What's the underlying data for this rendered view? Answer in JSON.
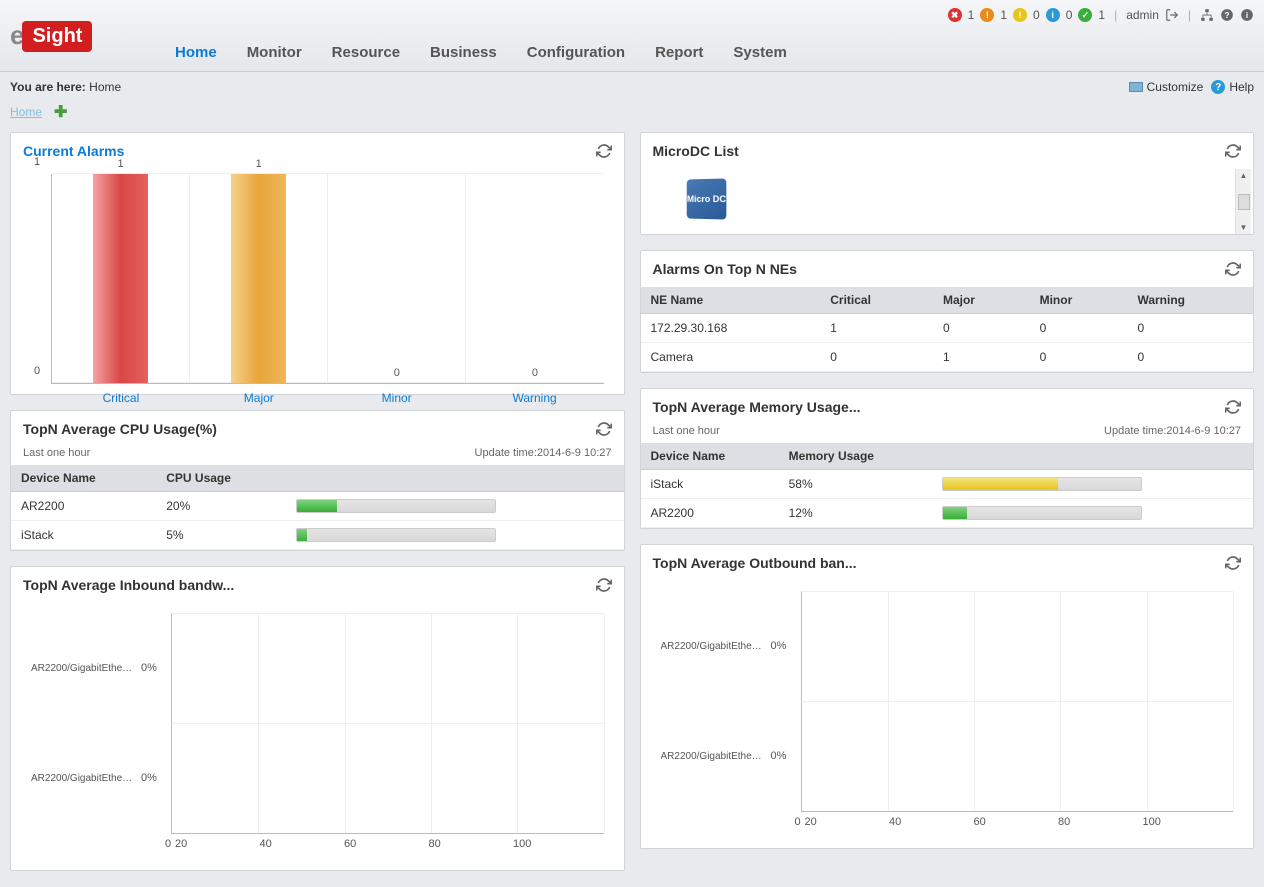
{
  "brand": {
    "prefix": "e",
    "name": "Sight"
  },
  "nav": {
    "items": [
      "Home",
      "Monitor",
      "Resource",
      "Business",
      "Configuration",
      "Report",
      "System"
    ],
    "active": 0
  },
  "status_counts": {
    "critical": "1",
    "major": "1",
    "warning": "0",
    "info": "0",
    "ok": "1"
  },
  "user": "admin",
  "breadcrumb": {
    "prefix": "You are here:",
    "location": "Home"
  },
  "actions": {
    "customize": "Customize",
    "help": "Help"
  },
  "tabs": {
    "home": "Home"
  },
  "panels": {
    "current_alarms": {
      "title": "Current Alarms"
    },
    "microdc": {
      "title": "MicroDC List",
      "cube": "Micro DC"
    },
    "alarms_top": {
      "title": "Alarms On Top N NEs",
      "headers": [
        "NE Name",
        "Critical",
        "Major",
        "Minor",
        "Warning"
      ],
      "rows": [
        [
          "172.29.30.168",
          "1",
          "0",
          "0",
          "0"
        ],
        [
          "Camera",
          "0",
          "1",
          "0",
          "0"
        ]
      ]
    },
    "cpu": {
      "title": "TopN Average CPU Usage(%)",
      "sub_left": "Last one hour",
      "sub_right": "Update time:2014-6-9 10:27",
      "headers": [
        "Device Name",
        "CPU Usage"
      ],
      "rows": [
        {
          "name": "AR2200",
          "pct": "20%",
          "val": 20
        },
        {
          "name": "iStack",
          "pct": "5%",
          "val": 5
        }
      ]
    },
    "mem": {
      "title": "TopN Average Memory Usage...",
      "sub_left": "Last one hour",
      "sub_right": "Update time:2014-6-9 10:27",
      "headers": [
        "Device Name",
        "Memory Usage"
      ],
      "rows": [
        {
          "name": "iStack",
          "pct": "58%",
          "val": 58,
          "color": "y"
        },
        {
          "name": "AR2200",
          "pct": "12%",
          "val": 12,
          "color": "g"
        }
      ]
    },
    "inbound": {
      "title": "TopN Average Inbound bandw...",
      "rows": [
        {
          "name": "AR2200/GigabitEthern...",
          "pct": "0%"
        },
        {
          "name": "AR2200/GigabitEthern...",
          "pct": "0%"
        }
      ]
    },
    "outbound": {
      "title": "TopN Average Outbound ban...",
      "rows": [
        {
          "name": "AR2200/GigabitEthern...",
          "pct": "0%"
        },
        {
          "name": "AR2200/GigabitEthern...",
          "pct": "0%"
        }
      ]
    }
  },
  "chart_data": {
    "type": "bar",
    "title": "Current Alarms",
    "categories": [
      "Critical",
      "Major",
      "Minor",
      "Warning"
    ],
    "values": [
      1,
      1,
      0,
      0
    ],
    "colors": [
      "#d84646",
      "#e8a53a",
      "#e6c61a",
      "#2a9bd8"
    ],
    "ylim": [
      0,
      1
    ],
    "yticks": [
      0,
      1
    ]
  },
  "hbar_ticks": [
    "0",
    "20",
    "40",
    "60",
    "80",
    "100"
  ]
}
